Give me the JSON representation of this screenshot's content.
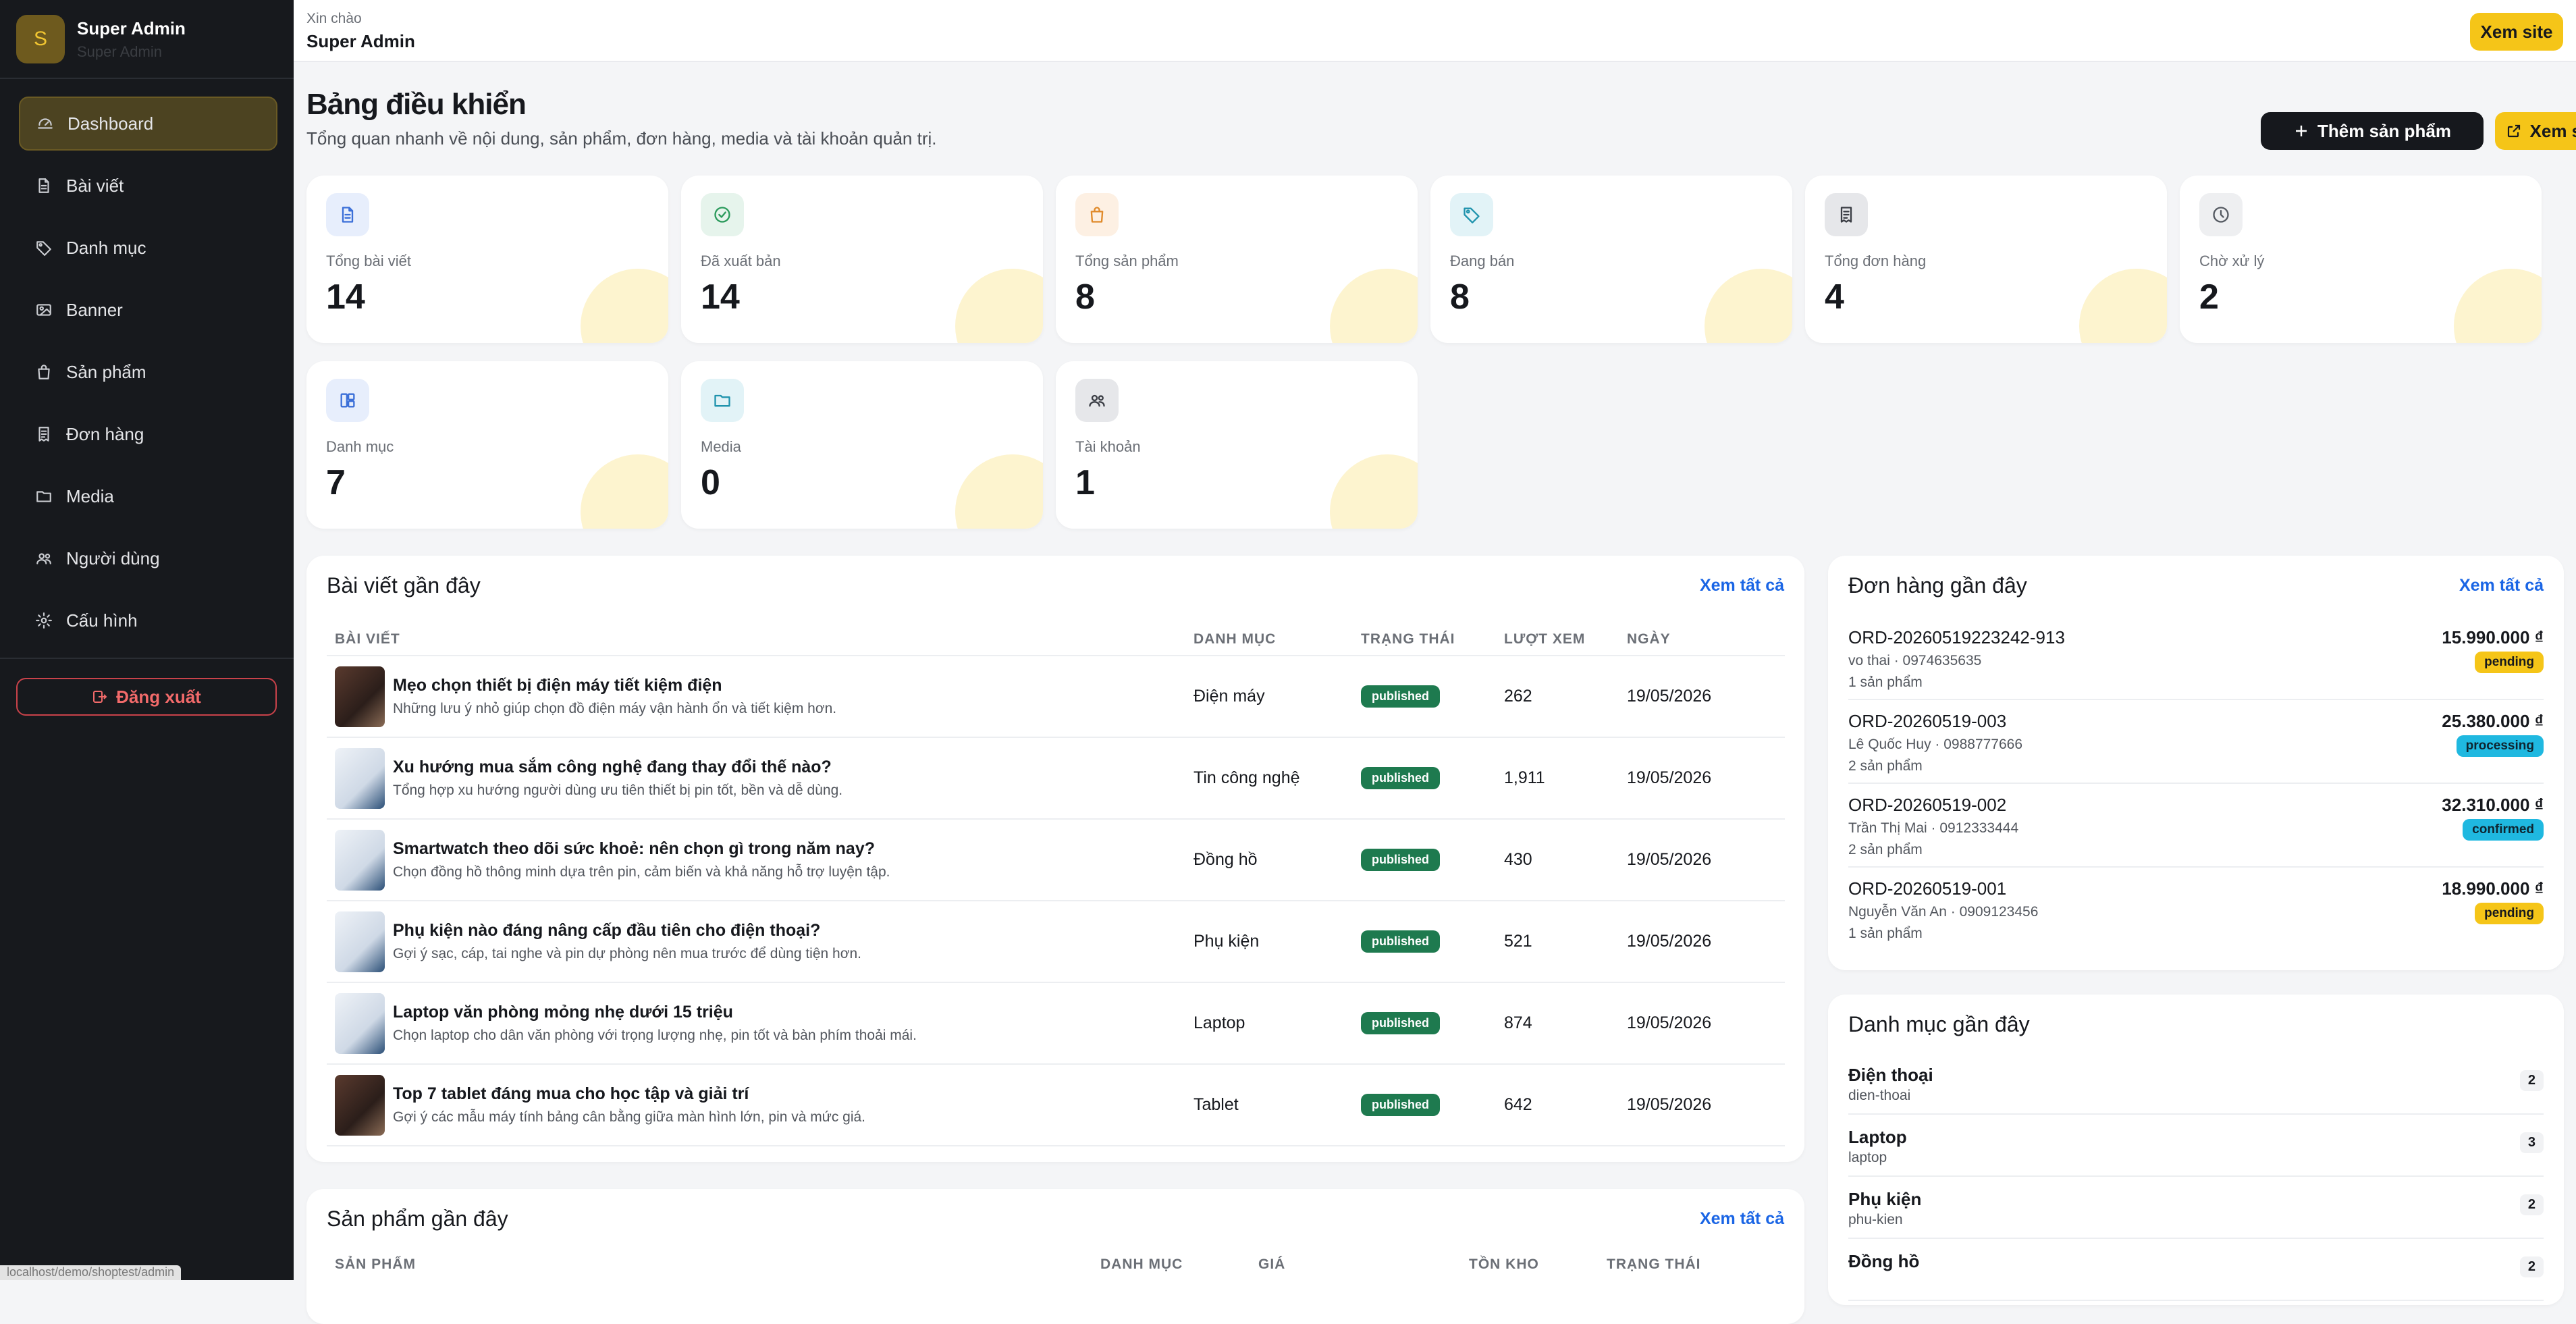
{
  "sidebar": {
    "user_name": "Super Admin",
    "user_role": "Super Admin",
    "avatar_initial": "S",
    "nav": [
      {
        "label": "Dashboard",
        "icon": "dashboard-icon"
      },
      {
        "label": "Bài viết",
        "icon": "document-icon"
      },
      {
        "label": "Danh mục",
        "icon": "tag-icon"
      },
      {
        "label": "Banner",
        "icon": "image-icon"
      },
      {
        "label": "Sản phẩm",
        "icon": "bag-icon"
      },
      {
        "label": "Đơn hàng",
        "icon": "receipt-icon"
      },
      {
        "label": "Media",
        "icon": "folder-icon"
      },
      {
        "label": "Người dùng",
        "icon": "users-icon"
      },
      {
        "label": "Cấu hình",
        "icon": "gear-icon"
      }
    ],
    "logout_label": "Đăng xuất",
    "status_url": "localhost/demo/shoptest/admin"
  },
  "topbar": {
    "greeting": "Xin chào",
    "user_name": "Super Admin",
    "view_site": "Xem site"
  },
  "header": {
    "title": "Bảng điều khiển",
    "subtitle": "Tổng quan nhanh về nội dung, sản phẩm, đơn hàng, media và tài khoản quản trị.",
    "add_product": "Thêm sản phẩm",
    "view_site": "Xem site"
  },
  "stats": [
    {
      "label": "Tổng bài viết",
      "value": "14",
      "icon": "document-icon",
      "color": "#e7eefc",
      "stroke": "#3b6fd8"
    },
    {
      "label": "Đã xuất bản",
      "value": "14",
      "icon": "check-circle-icon",
      "color": "#e6f4ec",
      "stroke": "#2a9a5b"
    },
    {
      "label": "Tổng sản phẩm",
      "value": "8",
      "icon": "bag-icon",
      "color": "#fdf0e3",
      "stroke": "#e08a2a"
    },
    {
      "label": "Đang bán",
      "value": "8",
      "icon": "tag-icon",
      "color": "#e2f3f7",
      "stroke": "#1f93ad"
    },
    {
      "label": "Tổng đơn hàng",
      "value": "4",
      "icon": "receipt-icon",
      "color": "#e6e7ea",
      "stroke": "#3a3d44"
    },
    {
      "label": "Chờ xử lý",
      "value": "2",
      "icon": "clock-icon",
      "color": "#eeeff1",
      "stroke": "#555a62"
    },
    {
      "label": "Danh mục",
      "value": "7",
      "icon": "grid-icon",
      "color": "#e7eefc",
      "stroke": "#3b6fd8"
    },
    {
      "label": "Media",
      "value": "0",
      "icon": "folder-icon",
      "color": "#e2f3f7",
      "stroke": "#1f93ad"
    },
    {
      "label": "Tài khoản",
      "value": "1",
      "icon": "users-icon",
      "color": "#e6e7ea",
      "stroke": "#3a3d44"
    }
  ],
  "posts": {
    "title": "Bài viết gần đây",
    "see_all": "Xem tất cả",
    "columns": [
      "BÀI VIẾT",
      "DANH MỤC",
      "TRẠNG THÁI",
      "LƯỢT XEM",
      "NGÀY"
    ],
    "rows": [
      {
        "title": "Mẹo chọn thiết bị điện máy tiết kiệm điện",
        "desc": "Những lưu ý nhỏ giúp chọn đồ điện máy vận hành ổn và tiết kiệm hơn.",
        "category": "Điện máy",
        "status": "published",
        "views": "262",
        "date": "19/05/2026",
        "thumb": "dark"
      },
      {
        "title": "Xu hướng mua sắm công nghệ đang thay đổi thế nào?",
        "desc": "Tổng hợp xu hướng người dùng ưu tiên thiết bị pin tốt, bền và dễ dùng.",
        "category": "Tin công nghệ",
        "status": "published",
        "views": "1,911",
        "date": "19/05/2026",
        "thumb": "light"
      },
      {
        "title": "Smartwatch theo dõi sức khoẻ: nên chọn gì trong năm nay?",
        "desc": "Chọn đồng hồ thông minh dựa trên pin, cảm biến và khả năng hỗ trợ luyện tập.",
        "category": "Đồng hồ",
        "status": "published",
        "views": "430",
        "date": "19/05/2026",
        "thumb": "light"
      },
      {
        "title": "Phụ kiện nào đáng nâng cấp đầu tiên cho điện thoại?",
        "desc": "Gợi ý sạc, cáp, tai nghe và pin dự phòng nên mua trước để dùng tiện hơn.",
        "category": "Phụ kiện",
        "status": "published",
        "views": "521",
        "date": "19/05/2026",
        "thumb": "light"
      },
      {
        "title": "Laptop văn phòng mỏng nhẹ dưới 15 triệu",
        "desc": "Chọn laptop cho dân văn phòng với trọng lượng nhẹ, pin tốt và bàn phím thoải mái.",
        "category": "Laptop",
        "status": "published",
        "views": "874",
        "date": "19/05/2026",
        "thumb": "light"
      },
      {
        "title": "Top 7 tablet đáng mua cho học tập và giải trí",
        "desc": "Gợi ý các mẫu máy tính bảng cân bằng giữa màn hình lớn, pin và mức giá.",
        "category": "Tablet",
        "status": "published",
        "views": "642",
        "date": "19/05/2026",
        "thumb": "dark"
      }
    ]
  },
  "orders": {
    "title": "Đơn hàng gần đây",
    "see_all": "Xem tất cả",
    "rows": [
      {
        "id": "ORD-20260519223242-913",
        "customer": "vo thai · 0974635635",
        "count": "1 sản phẩm",
        "price": "15.990.000 ₫",
        "status": "pending",
        "status_bg": "#f5c518",
        "status_fg": "#16181d"
      },
      {
        "id": "ORD-20260519-003",
        "customer": "Lê Quốc Huy · 0988777666",
        "count": "2 sản phẩm",
        "price": "25.380.000 ₫",
        "status": "processing",
        "status_bg": "#1fb8e0",
        "status_fg": "#0e2530"
      },
      {
        "id": "ORD-20260519-002",
        "customer": "Trần Thị Mai · 0912333444",
        "count": "2 sản phẩm",
        "price": "32.310.000 ₫",
        "status": "confirmed",
        "status_bg": "#1fb8e0",
        "status_fg": "#0e2530"
      },
      {
        "id": "ORD-20260519-001",
        "customer": "Nguyễn Văn An · 0909123456",
        "count": "1 sản phẩm",
        "price": "18.990.000 ₫",
        "status": "pending",
        "status_bg": "#f5c518",
        "status_fg": "#16181d"
      }
    ]
  },
  "categories": {
    "title": "Danh mục gần đây",
    "rows": [
      {
        "name": "Điện thoại",
        "slug": "dien-thoai",
        "count": "2"
      },
      {
        "name": "Laptop",
        "slug": "laptop",
        "count": "3"
      },
      {
        "name": "Phụ kiện",
        "slug": "phu-kien",
        "count": "2"
      },
      {
        "name": "Đồng hồ",
        "slug": "",
        "count": "2"
      }
    ]
  },
  "products": {
    "title": "Sản phẩm gần đây",
    "see_all": "Xem tất cả",
    "columns": [
      "SẢN PHẨM",
      "DANH MỤC",
      "GIÁ",
      "TỒN KHO",
      "TRẠNG THÁI"
    ]
  },
  "colors": {
    "accent": "#f5c518",
    "link": "#1a65e5",
    "sidebar": "#17191d",
    "published": "#1e7a4f"
  }
}
